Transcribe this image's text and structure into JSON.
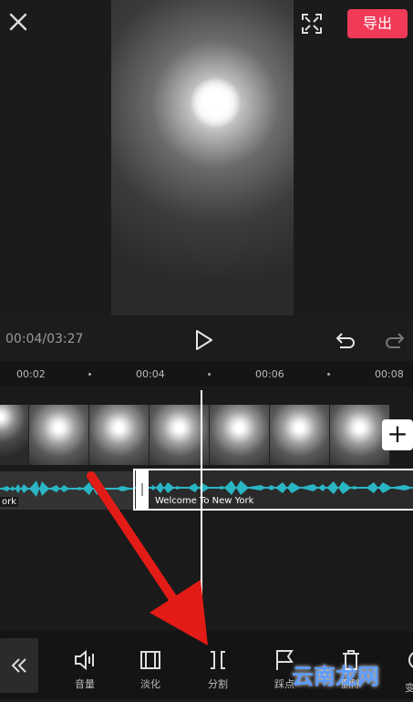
{
  "topbar": {
    "export_label": "导出"
  },
  "player": {
    "timecode": "00:04/03:27"
  },
  "ruler": {
    "ticks": [
      "00:02",
      "00:04",
      "00:06",
      "00:08"
    ]
  },
  "audio": {
    "left_label": "ork",
    "right_label": "Welcome To New York"
  },
  "toolbar": {
    "items": [
      {
        "label": "音量",
        "icon": "volume-icon"
      },
      {
        "label": "淡化",
        "icon": "fade-icon"
      },
      {
        "label": "分割",
        "icon": "split-icon"
      },
      {
        "label": "踩点",
        "icon": "beat-icon"
      },
      {
        "label": "删除",
        "icon": "delete-icon"
      },
      {
        "label": "变",
        "icon": "transform-icon"
      }
    ]
  },
  "watermark": {
    "text": "云南龙网"
  },
  "colors": {
    "accent": "#f03a57",
    "waveform": "#2ab5c5",
    "arrow": "#e31b17"
  }
}
